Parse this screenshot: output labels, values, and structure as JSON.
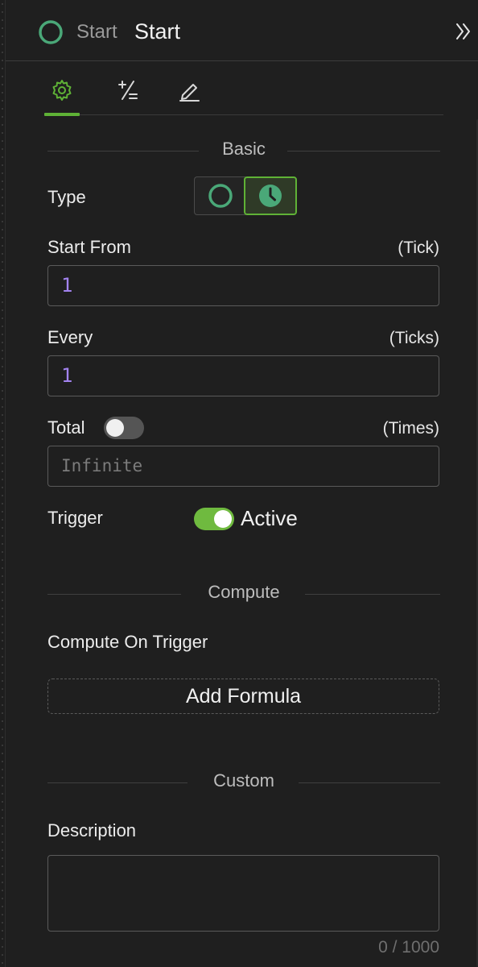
{
  "header": {
    "kind": "Start",
    "title": "Start"
  },
  "tabs": [
    {
      "name": "settings",
      "icon": "gear-icon",
      "active": true
    },
    {
      "name": "math",
      "icon": "plus-minus-icon",
      "active": false
    },
    {
      "name": "edit",
      "icon": "pencil-icon",
      "active": false
    }
  ],
  "basic": {
    "section_title": "Basic",
    "type_label": "Type",
    "type_options": [
      "circle-icon",
      "clock-icon"
    ],
    "type_selected": "clock-icon",
    "start_from": {
      "label": "Start From",
      "unit": "(Tick)",
      "value": "1"
    },
    "every": {
      "label": "Every",
      "unit": "(Ticks)",
      "value": "1"
    },
    "total": {
      "label": "Total",
      "unit": "(Times)",
      "placeholder": "Infinite",
      "enabled": false
    },
    "trigger": {
      "label": "Trigger",
      "state": "Active",
      "enabled": true
    }
  },
  "compute": {
    "section_title": "Compute",
    "label": "Compute On Trigger",
    "add_formula": "Add Formula"
  },
  "custom": {
    "section_title": "Custom",
    "description_label": "Description",
    "description_value": "",
    "counter": "0 / 1000"
  },
  "colors": {
    "accent": "#5fb236",
    "node_ring": "#4aa878",
    "number": "#a383f0"
  }
}
